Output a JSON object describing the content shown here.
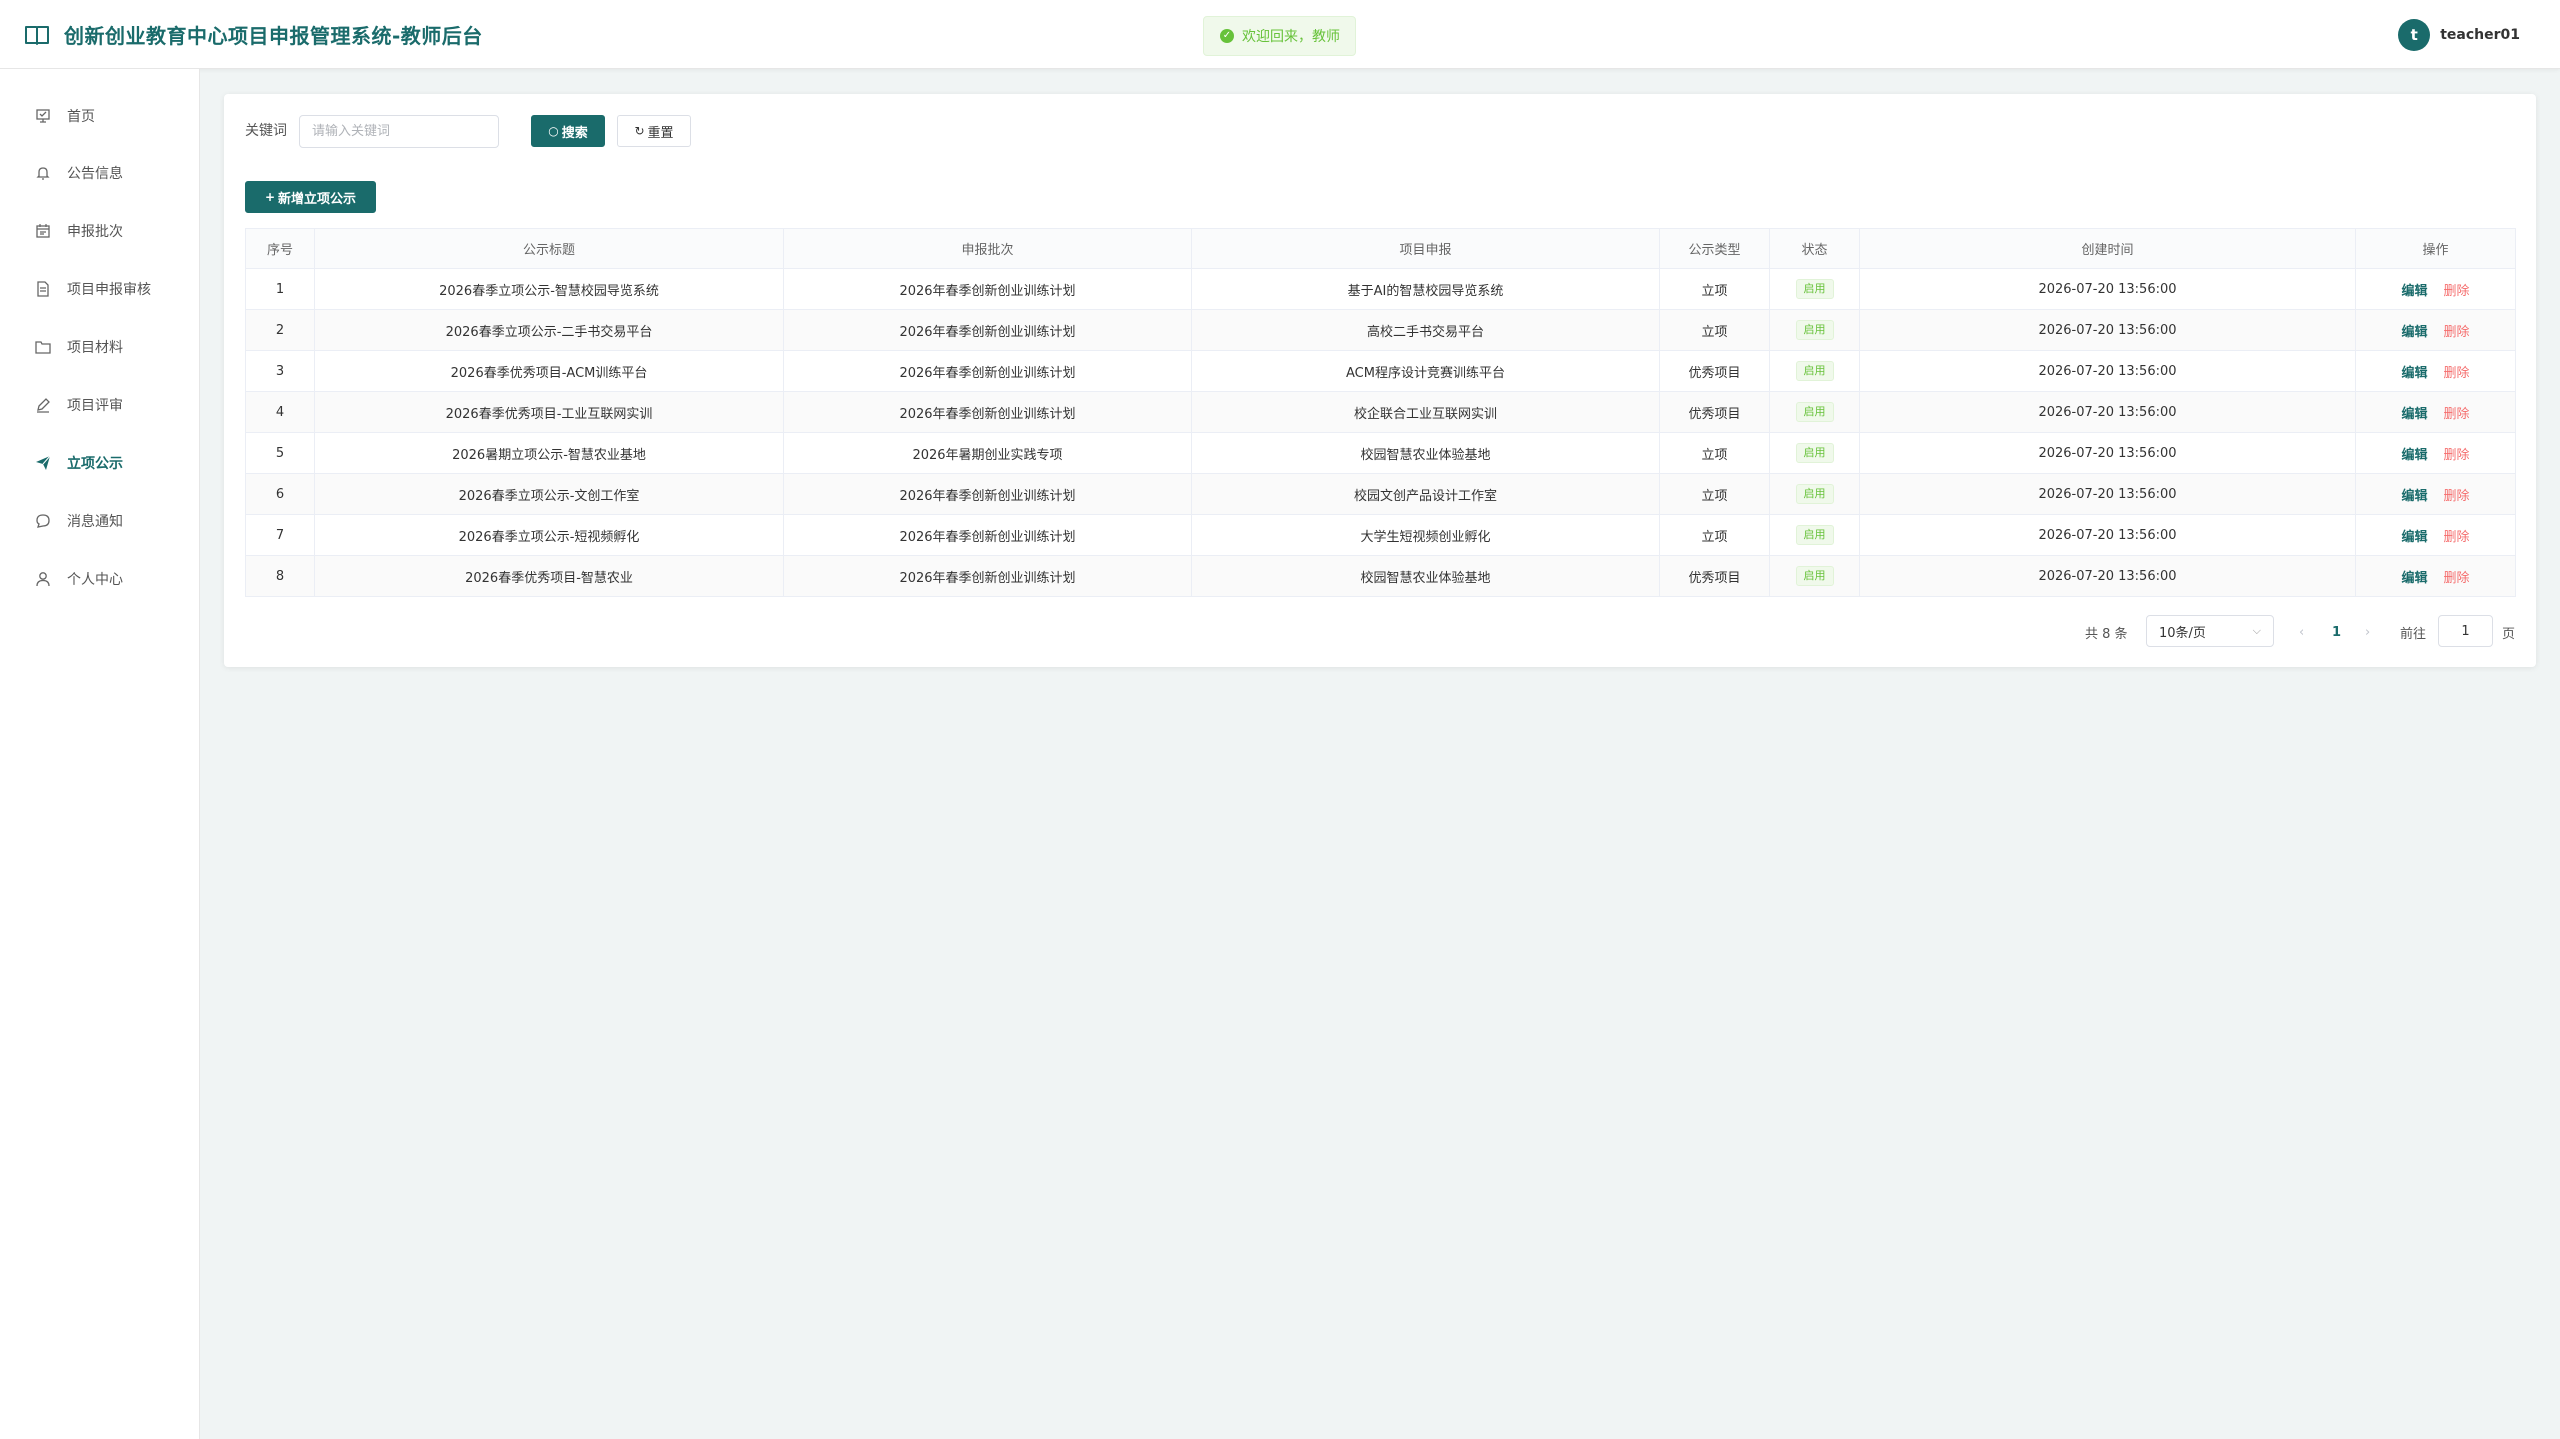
{
  "header": {
    "title": "创新创业教育中心项目申报管理系统-教师后台",
    "toast": "欢迎回来，教师",
    "avatar_letter": "t",
    "username": "teacher01"
  },
  "sidebar": {
    "items": [
      {
        "label": "首页",
        "icon": "home-icon"
      },
      {
        "label": "公告信息",
        "icon": "bell-icon"
      },
      {
        "label": "申报批次",
        "icon": "calendar-icon"
      },
      {
        "label": "项目申报审核",
        "icon": "document-icon"
      },
      {
        "label": "项目材料",
        "icon": "folder-icon"
      },
      {
        "label": "项目评审",
        "icon": "edit-icon"
      },
      {
        "label": "立项公示",
        "icon": "send-icon"
      },
      {
        "label": "消息通知",
        "icon": "message-icon"
      },
      {
        "label": "个人中心",
        "icon": "user-icon"
      }
    ],
    "active": "立项公示"
  },
  "search": {
    "label": "关键词",
    "placeholder": "请输入关键词",
    "value": "",
    "search_label": "搜索",
    "reset_label": "重置"
  },
  "toolbar": {
    "add_label": "新增立项公示"
  },
  "table": {
    "columns": [
      "序号",
      "公示标题",
      "申报批次",
      "项目申报",
      "公示类型",
      "状态",
      "创建时间",
      "操作"
    ],
    "rows": [
      {
        "no": "1",
        "title": "2026春季立项公示-智慧校园导览系统",
        "batch": "2026年春季创新创业训练计划",
        "project": "基于AI的智慧校园导览系统",
        "type": "立项",
        "status": "启用",
        "created": "2026-07-20 13:56:00"
      },
      {
        "no": "2",
        "title": "2026春季立项公示-二手书交易平台",
        "batch": "2026年春季创新创业训练计划",
        "project": "高校二手书交易平台",
        "type": "立项",
        "status": "启用",
        "created": "2026-07-20 13:56:00"
      },
      {
        "no": "3",
        "title": "2026春季优秀项目-ACM训练平台",
        "batch": "2026年春季创新创业训练计划",
        "project": "ACM程序设计竞赛训练平台",
        "type": "优秀项目",
        "status": "启用",
        "created": "2026-07-20 13:56:00"
      },
      {
        "no": "4",
        "title": "2026春季优秀项目-工业互联网实训",
        "batch": "2026年春季创新创业训练计划",
        "project": "校企联合工业互联网实训",
        "type": "优秀项目",
        "status": "启用",
        "created": "2026-07-20 13:56:00"
      },
      {
        "no": "5",
        "title": "2026暑期立项公示-智慧农业基地",
        "batch": "2026年暑期创业实践专项",
        "project": "校园智慧农业体验基地",
        "type": "立项",
        "status": "启用",
        "created": "2026-07-20 13:56:00"
      },
      {
        "no": "6",
        "title": "2026春季立项公示-文创工作室",
        "batch": "2026年春季创新创业训练计划",
        "project": "校园文创产品设计工作室",
        "type": "立项",
        "status": "启用",
        "created": "2026-07-20 13:56:00"
      },
      {
        "no": "7",
        "title": "2026春季立项公示-短视频孵化",
        "batch": "2026年春季创新创业训练计划",
        "project": "大学生短视频创业孵化",
        "type": "立项",
        "status": "启用",
        "created": "2026-07-20 13:56:00"
      },
      {
        "no": "8",
        "title": "2026春季优秀项目-智慧农业",
        "batch": "2026年春季创新创业训练计划",
        "project": "校园智慧农业体验基地",
        "type": "优秀项目",
        "status": "启用",
        "created": "2026-07-20 13:56:00"
      }
    ],
    "edit_label": "编辑",
    "delete_label": "删除"
  },
  "pagination": {
    "total": "共 8 条",
    "page_size": "10条/页",
    "prev": "‹",
    "current": "1",
    "next": "›",
    "goto_prefix": "前往",
    "goto_value": "1",
    "goto_suffix": "页"
  },
  "colors": {
    "accent": "#1a6b6b",
    "success": "#67c23a",
    "danger": "#f56c6c"
  }
}
